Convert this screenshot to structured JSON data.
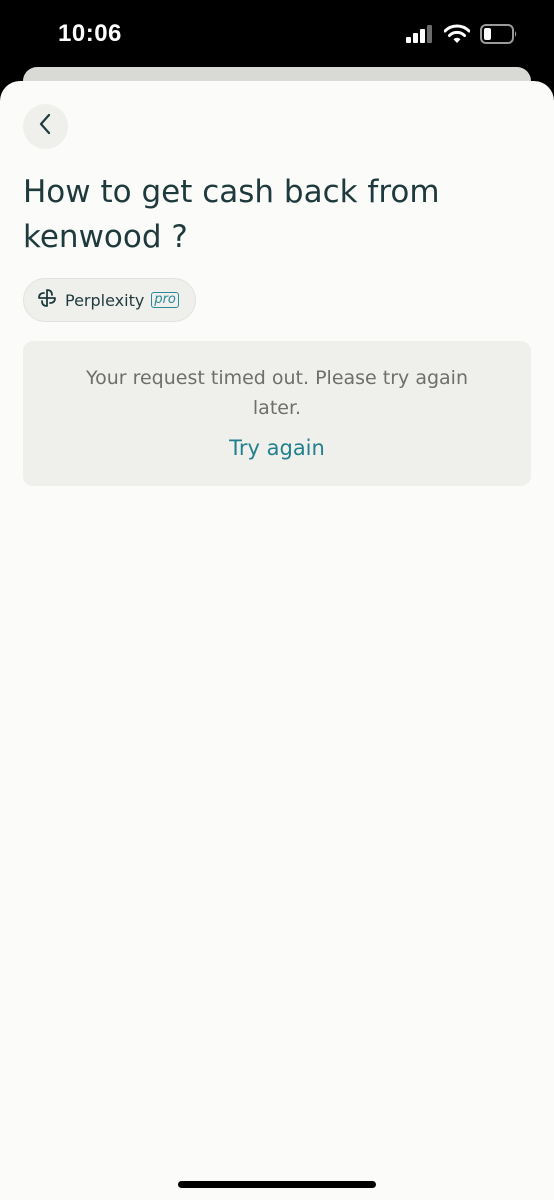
{
  "status_bar": {
    "time": "10:06",
    "icons": [
      "cellular-signal-icon",
      "wifi-icon",
      "battery-icon"
    ]
  },
  "header": {
    "back_icon": "chevron-left-icon"
  },
  "question": {
    "title": "How to get cash back from kenwood ?"
  },
  "model": {
    "icon": "perplexity-logo-icon",
    "name": "Perplexity",
    "badge": "pro"
  },
  "error": {
    "message": "Your request timed out. Please try again later.",
    "retry_label": "Try again"
  },
  "colors": {
    "text_primary": "#1f3a3d",
    "accent": "#22808e",
    "muted_text": "#6e6e6a",
    "card_background": "#efefec",
    "page_background": "#fbfbf9"
  }
}
